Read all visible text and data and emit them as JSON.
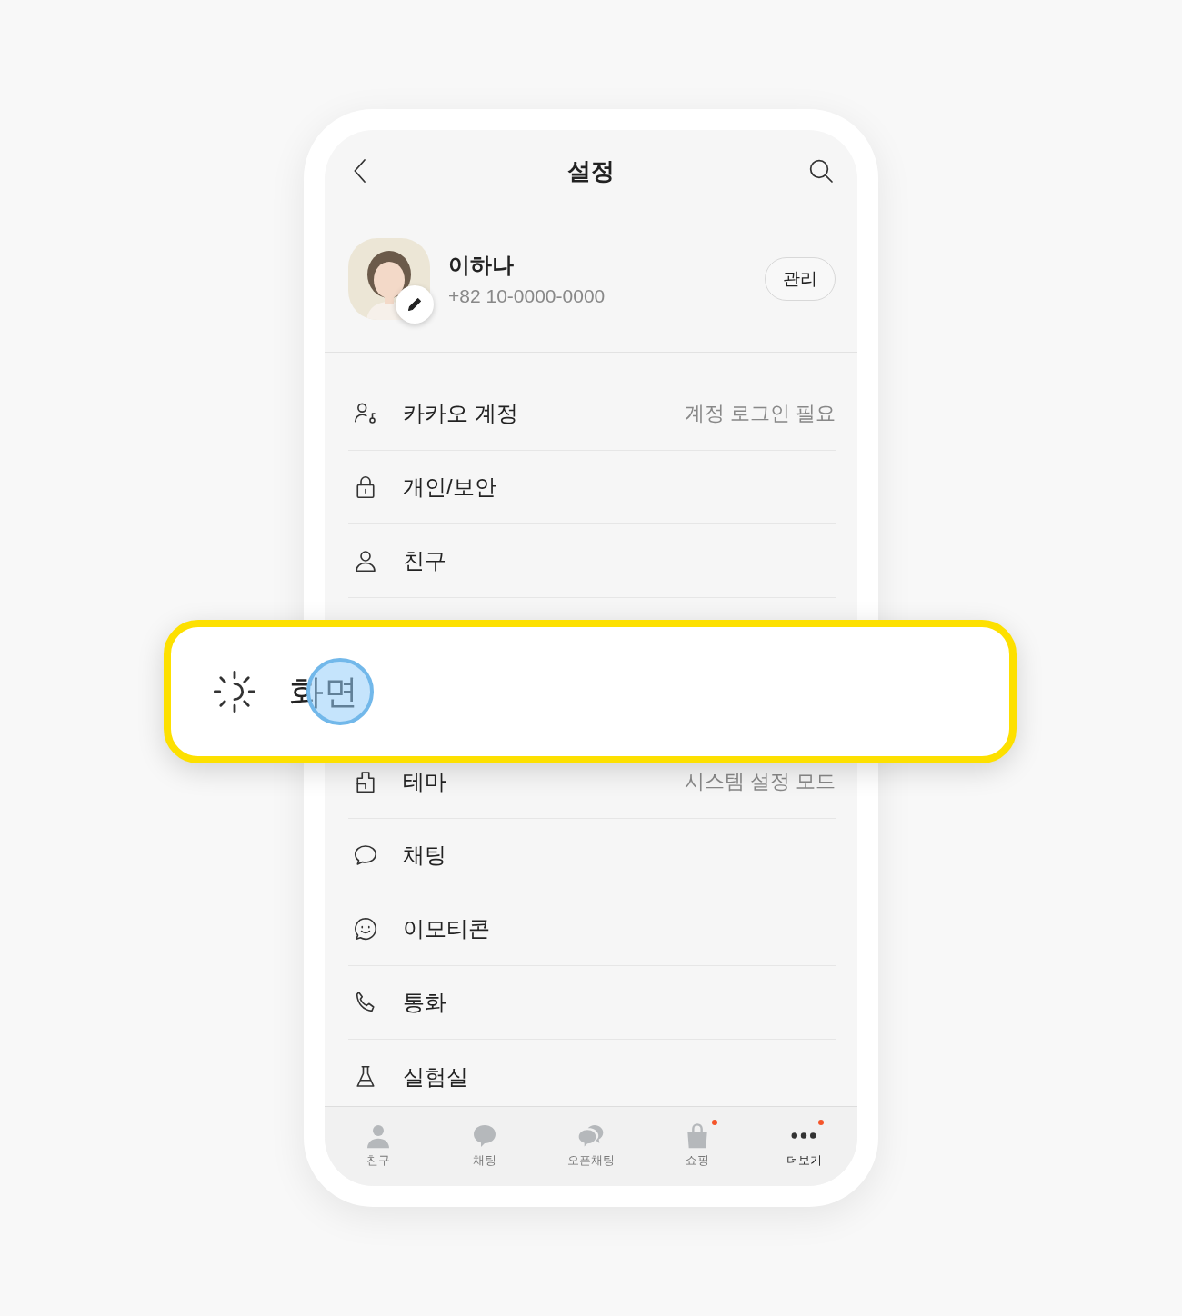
{
  "header": {
    "title": "설정"
  },
  "profile": {
    "name": "이하나",
    "phone": "+82 10-0000-0000",
    "manage_button": "관리"
  },
  "menu": [
    {
      "kind": "account",
      "label": "카카오 계정",
      "value": "계정 로그인 필요"
    },
    {
      "kind": "lock",
      "label": "개인/보안"
    },
    {
      "kind": "friend",
      "label": "친구"
    },
    {
      "kind": "hidden"
    },
    {
      "kind": "hidden"
    },
    {
      "kind": "theme",
      "label": "테마",
      "value": "시스템 설정 모드"
    },
    {
      "kind": "chat",
      "label": "채팅"
    },
    {
      "kind": "emoticon",
      "label": "이모티콘"
    },
    {
      "kind": "call",
      "label": "통화"
    },
    {
      "kind": "lab",
      "label": "실험실"
    }
  ],
  "highlight": {
    "label": "화면",
    "touched": true
  },
  "tabs": [
    {
      "kind": "friend",
      "label": "친구",
      "selected": false,
      "badge": false
    },
    {
      "kind": "chat",
      "label": "채팅",
      "selected": false,
      "badge": false
    },
    {
      "kind": "openchat",
      "label": "오픈채팅",
      "selected": false,
      "badge": false
    },
    {
      "kind": "shop",
      "label": "쇼핑",
      "selected": false,
      "badge": true
    },
    {
      "kind": "more",
      "label": "더보기",
      "selected": true,
      "badge": true
    }
  ]
}
